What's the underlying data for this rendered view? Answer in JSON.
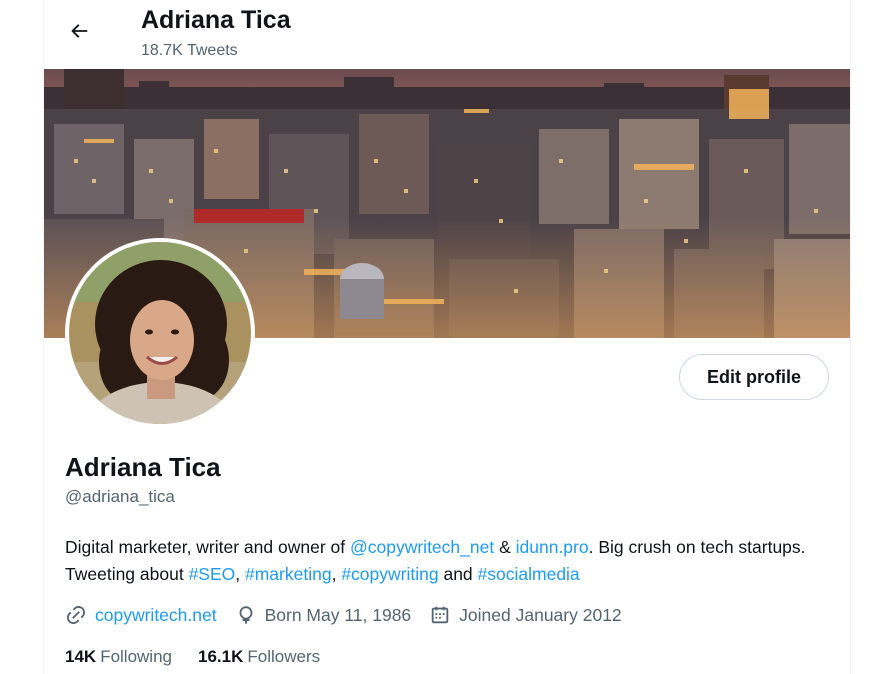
{
  "header": {
    "title": "Adriana Tica",
    "tweet_count": "18.7K Tweets",
    "back_icon": "arrow-left-icon"
  },
  "banner": {
    "description_icon": "city-night-banner"
  },
  "profile": {
    "name": "Adriana Tica",
    "handle": "@adriana_tica",
    "edit_label": "Edit profile",
    "bio": {
      "p1": "Digital marketer, writer and owner of ",
      "mention": "@copywritech_net",
      "p2": " & ",
      "site": "idunn.pro",
      "p3": ". Big crush on tech startups. Tweeting about ",
      "tag1": "#SEO",
      "sep1": ", ",
      "tag2": "#marketing",
      "sep2": ", ",
      "tag3": "#copywriting",
      "and": " and ",
      "tag4": "#socialmedia"
    },
    "meta": {
      "website": "copywritech.net",
      "born": "Born May 11, 1986",
      "joined": "Joined January 2012"
    },
    "stats": {
      "following_count": "14K",
      "following_label": "Following",
      "followers_count": "16.1K",
      "followers_label": "Followers"
    }
  },
  "colors": {
    "accent": "#1d9bf0",
    "text": "#0f1419",
    "muted": "#536471",
    "border": "#cfd9de"
  }
}
